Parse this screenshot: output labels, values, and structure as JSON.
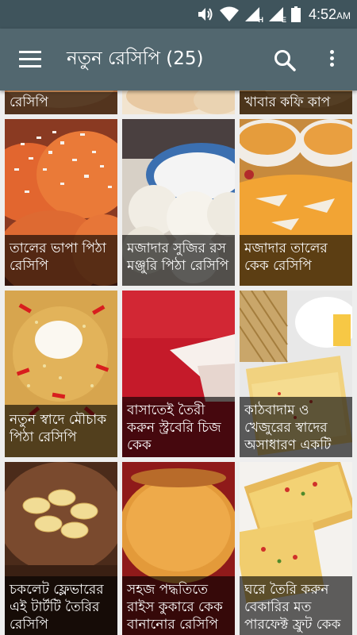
{
  "status": {
    "time": "4:52",
    "ampm": "AM",
    "signal1_tech": "H",
    "signal2_tech": "E"
  },
  "toolbar": {
    "title": "নতুন রেসিপি (25)",
    "menu_icon": "hamburger-menu-icon",
    "search_icon": "search-icon",
    "more_icon": "more-vert-icon"
  },
  "recipes": [
    {
      "title": "রেসিপি"
    },
    {
      "title": ""
    },
    {
      "title": "খাবার কফি কাপ"
    },
    {
      "title": "তালের ভাপা পিঠা রেসিপি"
    },
    {
      "title": "মজাদার সুজির রস মঞ্জুরি পিঠা রেসিপি"
    },
    {
      "title": "মজাদার তালের কেক রেসিপি"
    },
    {
      "title": "নতুন স্বাদে মৌচাক পিঠা রেসিপি"
    },
    {
      "title": "বাসাতেই তৈরী করুন স্ট্রবেরি চিজ কেক"
    },
    {
      "title": "কাঠবাদাম ও খেজুরের স্বাদের অসাধারণ একটি"
    },
    {
      "title": "চকলেট ফ্লেভারের এই টার্টটি তৈরির রেসিপি"
    },
    {
      "title": "সহজ পদ্ধতিতে রাইস কুকারে কেক বানানোর রেসিপি"
    },
    {
      "title": "ঘরে তৈরি করুন বেকারির মত পারফেক্ট ফ্রুট কেক"
    }
  ]
}
